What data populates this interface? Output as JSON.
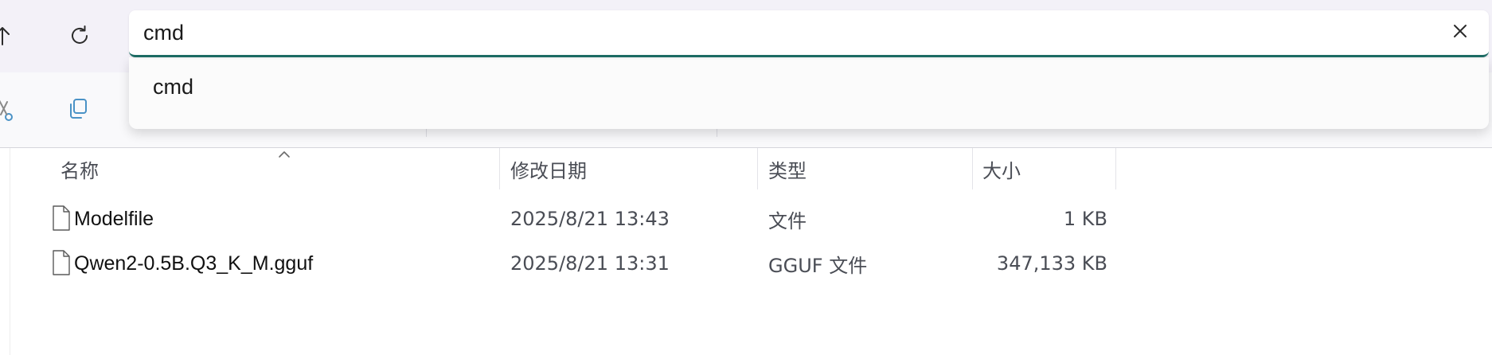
{
  "navigation": {
    "up_icon": "arrow-up-icon",
    "refresh_icon": "refresh-icon"
  },
  "address_bar": {
    "value": "cmd",
    "clear_icon": "close-icon",
    "accent_color": "#1c6b63"
  },
  "suggestions": [
    {
      "label": "cmd"
    }
  ],
  "toolbar": {
    "cut_icon": "scissors-icon",
    "copy_icon": "copy-icon"
  },
  "file_list": {
    "columns": [
      {
        "label": "名称"
      },
      {
        "label": "修改日期"
      },
      {
        "label": "类型"
      },
      {
        "label": "大小"
      }
    ],
    "sort_icon": "sort-ascending-icon",
    "rows": [
      {
        "name": "Modelfile",
        "modified": "2025/8/21 13:43",
        "type": "文件",
        "size": "1 KB",
        "icon": "file-icon"
      },
      {
        "name": "Qwen2-0.5B.Q3_K_M.gguf",
        "modified": "2025/8/21 13:31",
        "type": "GGUF 文件",
        "size": "347,133 KB",
        "icon": "file-icon"
      }
    ]
  }
}
